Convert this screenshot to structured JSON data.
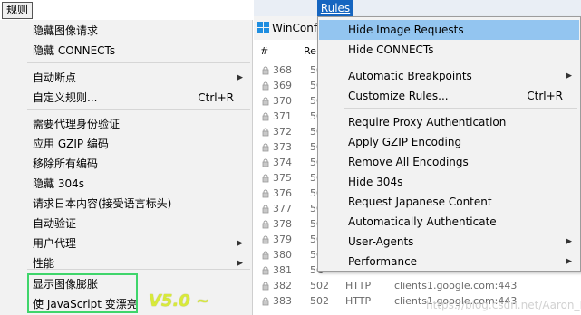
{
  "cn_menu": {
    "title": "规则",
    "items": [
      {
        "label": "隐藏图像请求"
      },
      {
        "label": "隐藏 CONNECTs"
      },
      {
        "label": "自动断点",
        "submenu": true
      },
      {
        "label": "自定义规则...",
        "shortcut": "Ctrl+R"
      },
      {
        "label": "需要代理身份验证"
      },
      {
        "label": "应用 GZIP 编码"
      },
      {
        "label": "移除所有编码"
      },
      {
        "label": "隐藏 304s"
      },
      {
        "label": "请求日本内容(接受语言标头)"
      },
      {
        "label": "自动验证"
      },
      {
        "label": "用户代理",
        "submenu": true
      },
      {
        "label": "性能",
        "submenu": true
      },
      {
        "label": "显示图像膨胀"
      },
      {
        "label": "使 JavaScript 变漂亮"
      }
    ],
    "version_note": "V5.0 ~"
  },
  "en_menu": {
    "title": "Rules",
    "items": [
      {
        "label": "Hide Image Requests",
        "highlighted": true
      },
      {
        "label": "Hide CONNECTs"
      },
      {
        "label": "Automatic Breakpoints",
        "submenu": true
      },
      {
        "label": "Customize Rules...",
        "shortcut": "Ctrl+R"
      },
      {
        "label": "Require Proxy Authentication"
      },
      {
        "label": "Apply GZIP Encoding"
      },
      {
        "label": "Remove All Encodings"
      },
      {
        "label": "Hide 304s"
      },
      {
        "label": "Request Japanese Content"
      },
      {
        "label": "Automatically Authenticate"
      },
      {
        "label": "User-Agents",
        "submenu": true
      },
      {
        "label": "Performance",
        "submenu": true
      }
    ]
  },
  "window": {
    "title_partial": "WinConf"
  },
  "grid": {
    "headers": [
      "#",
      "Re"
    ],
    "rows": [
      {
        "num": "368",
        "res": "5C"
      },
      {
        "num": "369",
        "res": "5C"
      },
      {
        "num": "370",
        "res": "5C"
      },
      {
        "num": "371",
        "res": "5C"
      },
      {
        "num": "372",
        "res": "5C"
      },
      {
        "num": "373",
        "res": "5C"
      },
      {
        "num": "374",
        "res": "5C"
      },
      {
        "num": "375",
        "res": "5C"
      },
      {
        "num": "376",
        "res": "5C"
      },
      {
        "num": "377",
        "res": "5C"
      },
      {
        "num": "378",
        "res": "5C"
      },
      {
        "num": "379",
        "res": "5C"
      },
      {
        "num": "380",
        "res": "5C"
      },
      {
        "num": "381",
        "res": "5C"
      },
      {
        "num": "382",
        "res": "502",
        "proto": "HTTP",
        "host": "clients1.google.com:443"
      },
      {
        "num": "383",
        "res": "502",
        "proto": "HTTP",
        "host": "clients1.google.com:443"
      }
    ]
  },
  "watermark": "https://blog.csdn.net/Aaron_Miller",
  "colors": {
    "menu_bg": "#f2f2f2",
    "highlight": "#93c5f0",
    "rules_tab": "#1565c0",
    "green_box": "#3fd56b",
    "version_note": "#d8ea3a"
  }
}
